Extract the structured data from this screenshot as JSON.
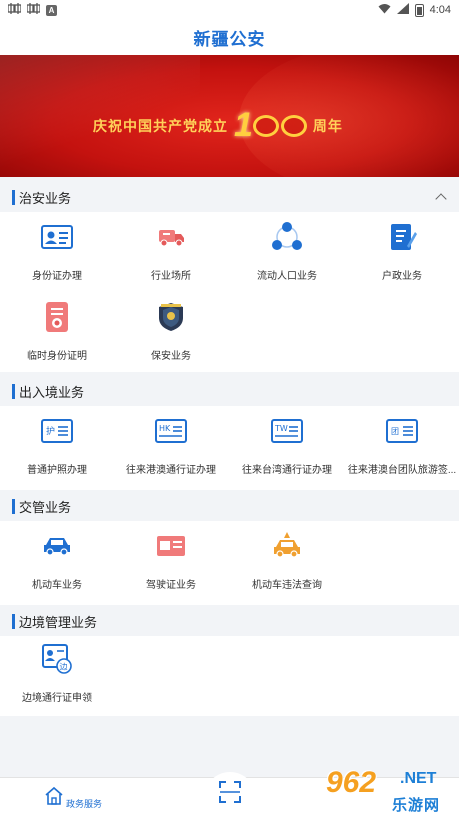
{
  "status_bar": {
    "icons": [
      "notification-icon",
      "notification-icon",
      "a-icon"
    ],
    "a_glyph": "A",
    "time": "4:04"
  },
  "header": {
    "title": "新疆公安"
  },
  "banner": {
    "text_left": "庆祝中国共产党成立",
    "number": "1",
    "text_right": "周年"
  },
  "sections": [
    {
      "title": "治安业务",
      "items": [
        {
          "label": "身份证办理",
          "icon": "id-card-icon"
        },
        {
          "label": "行业场所",
          "icon": "truck-icon"
        },
        {
          "label": "流动人口业务",
          "icon": "people-network-icon"
        },
        {
          "label": "户政业务",
          "icon": "notebook-pen-icon"
        },
        {
          "label": "临时身份证明",
          "icon": "temporary-certificate-icon"
        },
        {
          "label": "保安业务",
          "icon": "security-badge-icon"
        }
      ]
    },
    {
      "title": "出入境业务",
      "items": [
        {
          "label": "普通护照办理",
          "icon": "passport-icon",
          "tag": "护"
        },
        {
          "label": "往来港澳通行证办理",
          "icon": "hk-permit-icon",
          "tag": "HK"
        },
        {
          "label": "往来台湾通行证办理",
          "icon": "tw-permit-icon",
          "tag": "TW"
        },
        {
          "label": "往来港澳台团队旅游签...",
          "icon": "group-visa-icon",
          "tag": "团"
        }
      ]
    },
    {
      "title": "交管业务",
      "items": [
        {
          "label": "机动车业务",
          "icon": "car-icon"
        },
        {
          "label": "驾驶证业务",
          "icon": "driver-license-icon"
        },
        {
          "label": "机动车违法查询",
          "icon": "car-violation-icon"
        }
      ]
    },
    {
      "title": "边境管理业务",
      "items": [
        {
          "label": "边境通行证申领",
          "icon": "border-pass-icon",
          "tag": "边"
        }
      ]
    }
  ],
  "bottom_bar": {
    "home_label": "政务服务",
    "scan_icon": "scan-icon"
  },
  "watermark": {
    "num": "962",
    "suffix": ".NET",
    "sub": "乐游网"
  },
  "colors": {
    "accent": "#1f6fd1",
    "banner_red": "#c4120f",
    "gold": "#ffcf3f",
    "icon_red": "#e45a5a",
    "icon_blue": "#1f6fd1",
    "icon_orange": "#f0a030"
  }
}
